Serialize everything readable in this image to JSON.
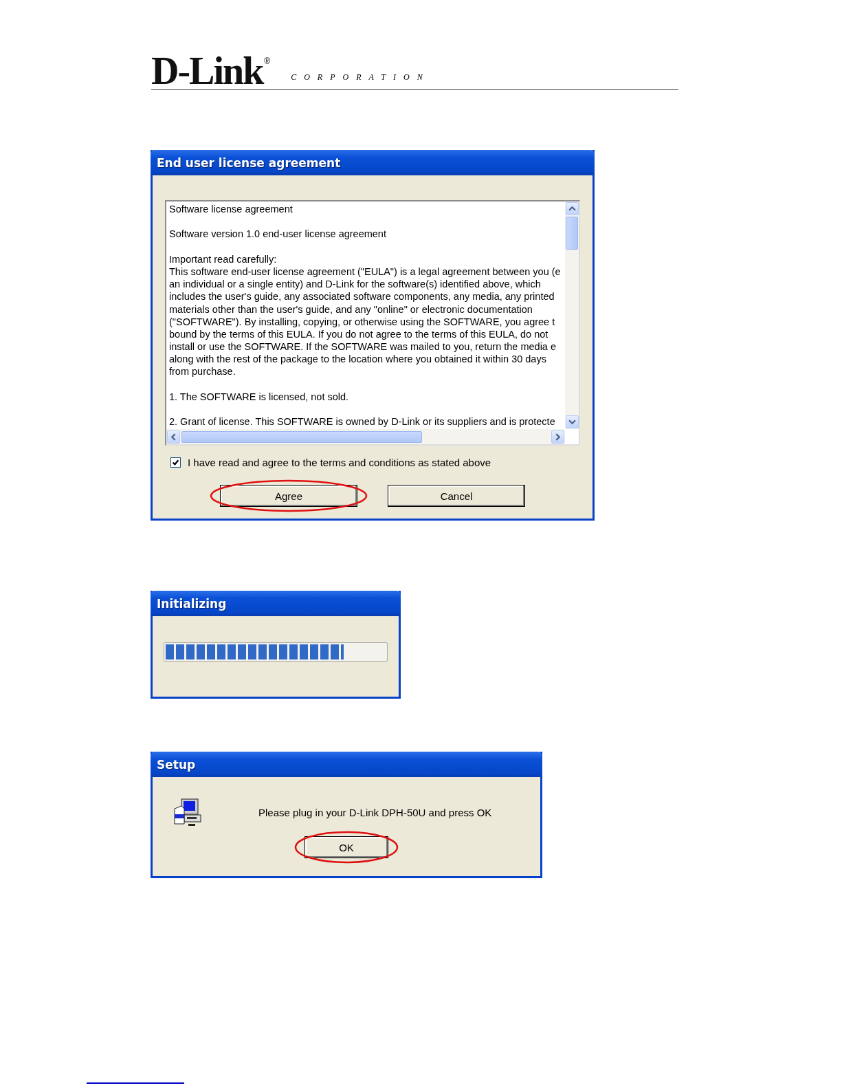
{
  "header": {
    "logo": "D-Link",
    "registered": "®",
    "subtitle": "CORPORATION"
  },
  "eula": {
    "title": "End user license agreement",
    "paragraphs": [
      [
        "Software license agreement"
      ],
      [
        "Software version 1.0 end-user license agreement"
      ],
      [
        "Important read carefully:",
        "This software end-user license agreement (\"EULA\") is a legal agreement between you (e",
        "an individual or a single entity) and D-Link for the software(s) identified above, which",
        "includes the user's guide, any associated software components, any media, any printed",
        "materials other than the user's guide, and any \"online\" or electronic documentation",
        "(\"SOFTWARE\"). By installing, copying, or otherwise using the SOFTWARE, you agree t",
        "bound by the terms of this EULA. If you do not agree to the terms of this EULA, do not",
        "install or use the SOFTWARE. If the SOFTWARE was mailed to you, return the media e",
        "along with the rest of the package to the location where you obtained it within 30 days",
        "from purchase."
      ],
      [
        "1. The SOFTWARE is licensed, not sold."
      ],
      [
        "2. Grant of license. This SOFTWARE is owned by D-Link or its suppliers and is protecte"
      ]
    ],
    "checkbox": {
      "label": "I have read and agree to the terms and conditions as stated above",
      "checked": true
    },
    "buttons": [
      {
        "label": "Agree",
        "circled": true
      },
      {
        "label": "Cancel",
        "circled": false
      }
    ]
  },
  "init": {
    "title": "Initializing",
    "level": 0.81
  },
  "setup": {
    "title": "Setup",
    "message": "Please plug in your D-Link DPH-50U and press OK",
    "buttons": [
      {
        "label": "OK",
        "circled": true
      }
    ]
  }
}
